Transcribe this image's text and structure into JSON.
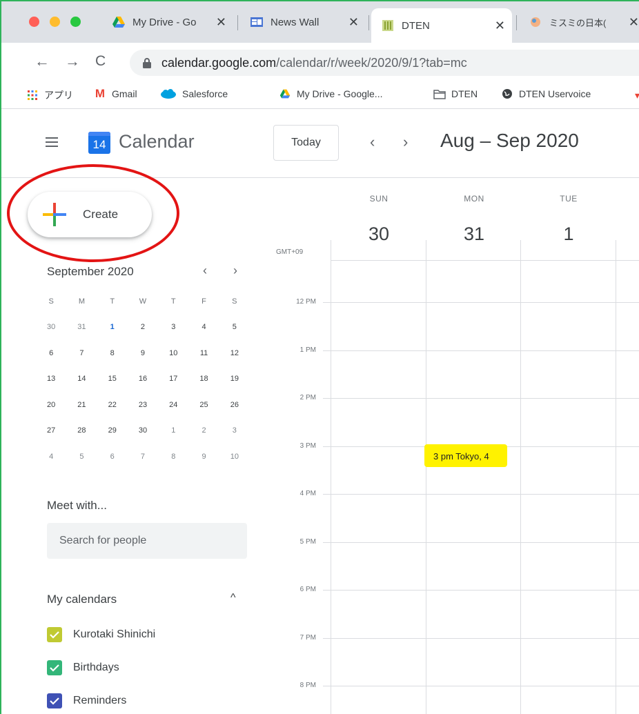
{
  "browser": {
    "tabs": [
      {
        "label": "My Drive - Go",
        "icon": "google-drive-icon"
      },
      {
        "label": "News Wall",
        "icon": "news-wall-icon"
      },
      {
        "label": "DTEN",
        "icon": "dten-icon"
      },
      {
        "label": "ミスミの日本(",
        "icon": "misumi-icon"
      }
    ],
    "url_domain": "calendar.google.com",
    "url_path": "/calendar/r/week/2020/9/1?tab=mc",
    "bookmarks": [
      {
        "label": "アプリ",
        "icon": "apps-grid-icon"
      },
      {
        "label": "Gmail",
        "icon": "gmail-icon"
      },
      {
        "label": "Salesforce",
        "icon": "salesforce-icon"
      },
      {
        "label": "My Drive - Google...",
        "icon": "google-drive-icon"
      },
      {
        "label": "DTEN",
        "icon": "folder-icon"
      },
      {
        "label": "DTEN Uservoice",
        "icon": "globe-icon"
      }
    ]
  },
  "header": {
    "logo_day": "14",
    "app_name": "Calendar",
    "today_label": "Today",
    "prev_icon": "‹",
    "next_icon": "›",
    "date_range": "Aug – Sep 2020"
  },
  "sidebar": {
    "create_label": "Create",
    "mini_month": "September 2020",
    "weekday_headers": [
      "S",
      "M",
      "T",
      "W",
      "T",
      "F",
      "S"
    ],
    "weeks": [
      [
        "30",
        "31",
        "1",
        "2",
        "3",
        "4",
        "5"
      ],
      [
        "6",
        "7",
        "8",
        "9",
        "10",
        "11",
        "12"
      ],
      [
        "13",
        "14",
        "15",
        "16",
        "17",
        "18",
        "19"
      ],
      [
        "20",
        "21",
        "22",
        "23",
        "24",
        "25",
        "26"
      ],
      [
        "27",
        "28",
        "29",
        "30",
        "1",
        "2",
        "3"
      ],
      [
        "4",
        "5",
        "6",
        "7",
        "8",
        "9",
        "10"
      ]
    ],
    "selected_day": "1",
    "meet_with_title": "Meet with...",
    "people_placeholder": "Search for people",
    "my_calendars_title": "My calendars",
    "calendars": [
      {
        "label": "Kurotaki Shinichi",
        "color": "#c0ca33"
      },
      {
        "label": "Birthdays",
        "color": "#33b679"
      },
      {
        "label": "Reminders",
        "color": "#3f51b5"
      }
    ]
  },
  "week": {
    "timezone": "GMT+09",
    "days": [
      {
        "name": "SUN",
        "num": "30"
      },
      {
        "name": "MON",
        "num": "31"
      },
      {
        "name": "TUE",
        "num": "1"
      }
    ],
    "hours": [
      "12 PM",
      "1 PM",
      "2 PM",
      "3 PM",
      "4 PM",
      "5 PM",
      "6 PM",
      "7 PM",
      "8 PM"
    ],
    "event": {
      "title": "3 pm Tokyo, 4",
      "color": "#fff200",
      "day": "MON",
      "hour": "3 PM"
    }
  },
  "colors": {
    "brand_blue": "#1a73e8",
    "annotation_red": "#e31414",
    "event_yellow": "#fff200"
  }
}
